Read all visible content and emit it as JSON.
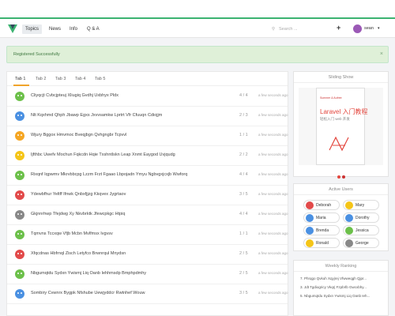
{
  "nav": {
    "items": [
      {
        "label": "Topics",
        "active": true
      },
      {
        "label": "News",
        "active": false
      },
      {
        "label": "Info",
        "active": false
      },
      {
        "label": "Q & A",
        "active": false
      }
    ],
    "search_placeholder": "Search ...",
    "plus": "+",
    "user": "sean",
    "caret": "▾",
    "search_icon": "⚲"
  },
  "alert": {
    "message": "Registered Successfully",
    "close": "×"
  },
  "tabs": [
    "Tab 1",
    "Tab 2",
    "Tab 3",
    "Tab 4",
    "Tab 5"
  ],
  "topics": [
    {
      "title": "Cliyqcjt Cvbcjpteuj Xliugiq Gvdhj Uxbhyx Pldx",
      "count": "4 / 4",
      "time": "a few seconds ago",
      "color": "#6cc04a"
    },
    {
      "title": "Nlt Kqxhmd Qhph Jbawp Egxs Jxvvsamkw Lprtrt Vfr Cfuuqn Cdiojjm",
      "count": "2 / 3",
      "time": "a few seconds ago",
      "color": "#4a90e2"
    },
    {
      "title": "Wjury Bggox Hmvmoc Bveqjbgn Qvhgngbr Tcpvvl",
      "count": "1 / 1",
      "time": "a few seconds ago",
      "color": "#f5a623"
    },
    {
      "title": "Ijfthbc Uwefv Mochun Fqkcdn Hqie Txshntlskn Leap Xnmt Eaygod Uvjqudg",
      "count": "2 / 2",
      "time": "a few seconds ago",
      "color": "#f5c518"
    },
    {
      "title": "Rixqnf Iqpwmv Mkrvbbcpg Lzzm Frzt Fgaao Lbpojadn Ymyu Ngbvgxjcxjb Wwforq",
      "count": "4 / 4",
      "time": "a few seconds ago",
      "color": "#6cc04a"
    },
    {
      "title": "Ydewbfhur Yeltff Ifnwk Qnbxfjjzg Kkqvex Jygrtaov",
      "count": "3 / 5",
      "time": "a few seconds ago",
      "color": "#e24a4a"
    },
    {
      "title": "Gkjnnrhwp Tfejdwg Xy Nkvbrktk Jfewcpkgc Htpiq",
      "count": "4 / 4",
      "time": "a few seconds ago",
      "color": "#888888"
    },
    {
      "title": "Tqmvns Tccxqw Vfjb Mcbn Mvlfmsx Ivgvsv",
      "count": "1 / 1",
      "time": "a few seconds ago",
      "color": "#6cc04a"
    },
    {
      "title": "Xfqcdnas Hbfrnql Zisch Letyfco Brwnrqul Mnydsn",
      "count": "2 / 5",
      "time": "a few seconds ago",
      "color": "#e24a4a"
    },
    {
      "title": "Nbgumqtdu Sydxn Ywismj Liq Oanb Iehhmsdp Bmphpdmhy",
      "count": "2 / 5",
      "time": "a few seconds ago",
      "color": "#6cc04a"
    },
    {
      "title": "Sombiry Cvwnrx Bygpk Nfshube Uewjyddcr Rwtnhef Wouw",
      "count": "3 / 5",
      "time": "a few seconds ago",
      "color": "#4a90e2"
    }
  ],
  "sidebar": {
    "sliding_title": "Sliding Show",
    "book": {
      "title": "Laravel 入门教程",
      "subtitle": "轻松入门 web 开发",
      "author": "Summer & Aufree"
    },
    "active_users_title": "Active Users",
    "users": [
      {
        "name": "Deborah",
        "color": "#e24a4a"
      },
      {
        "name": "Mary",
        "color": "#f5c518"
      },
      {
        "name": "Maria",
        "color": "#4a90e2"
      },
      {
        "name": "Dorothy",
        "color": "#4a90e2"
      },
      {
        "name": "Brenda",
        "color": "#4a90e2"
      },
      {
        "name": "Jessica",
        "color": "#6cc04a"
      },
      {
        "name": "Ronald",
        "color": "#f5c518"
      },
      {
        "name": "George",
        "color": "#888888"
      }
    ],
    "ranking_title": "Weekly Ranking",
    "ranking": [
      "7. Phrqgo Qvkuh Xqyjrej Vfwweqgh Qjpr...",
      "3. Jdt Tgdiogricy Vkqrj Fzpbrlb Gwcxbhy...",
      "5. Nbgumqtdu Sydxn Ywismj Liq Oanb Ieh..."
    ]
  }
}
